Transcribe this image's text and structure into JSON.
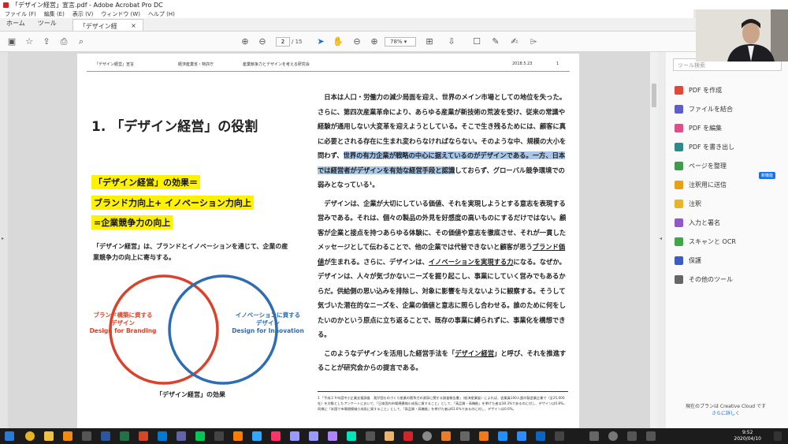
{
  "window": {
    "title": "「デザイン経営」宣言.pdf - Adobe Acrobat Pro DC"
  },
  "menu": [
    "ファイル (F)",
    "編集 (E)",
    "表示 (V)",
    "ウィンドウ (W)",
    "ヘルプ (H)"
  ],
  "tabs": {
    "home": "ホーム",
    "tools": "ツール",
    "document": "「デザイン経営」宣言...",
    "close": "×"
  },
  "toolbar": {
    "page_current": "2",
    "page_total": "/ 15",
    "zoom": "78%"
  },
  "pdf": {
    "header": {
      "h1": "「デザイン経営」宣言",
      "h2": "経済産業省・特許庁",
      "h3": "産業競争力とデザインを考える研究会",
      "date": "2018.5.23",
      "pagenum": "1"
    },
    "section_title": "1. 「デザイン経営」の役割",
    "yellow": [
      "「デザイン経営」の効果＝",
      "ブランド力向上+ イノベーション力向上",
      "=企業競争力の向上"
    ],
    "left_text": "「デザイン経営」は、ブランドとイノベーションを通じて、企業の産業競争力の向上に寄与する。",
    "venn": {
      "left_l1": "ブランド構築に資する",
      "left_l2": "デザイン",
      "left_l3": "Design for Branding",
      "right_l1": "イノベーションに資する",
      "right_l2": "デザイン",
      "right_l3": "Design for Innovation",
      "caption": "「デザイン経営」の効果",
      "color_left": "#d9432b",
      "color_right": "#2f6db3"
    },
    "p1_a": "日本は人口・労働力の減少局面を迎え、世界のメイン市場としての地位を失った。さらに、第四次産業革命により、あらゆる産業が新技術の荒波を受け、従来の常識や経験が通用しない大変革を迎えようとしている。そこで生き残るためには、顧客に真に必要とされる存在に生まれ変わらなければならない。そのような中、規模の大小を問わず、",
    "p1_hl": "世界の有力企業が戦略の中心に据えているのがデザインである。一方、日本では経営者がデザインを有効な経営手段と認識",
    "p1_b": "しておらず、グローバル競争環境での弱みとなっている¹。",
    "p2_a": "デザインは、企業が大切にしている価値、それを実現しようとする意志を表現する営みである。それは、個々の製品の外見を好感度の高いものにするだけではない。顧客が企業と接点を持つあらゆる体験に、その価値や意志を徹底させ、それが一貫したメッセージとして伝わることで、他の企業では代替できないと顧客が思う",
    "p2_ul1": "ブランド価値",
    "p2_b": "が生まれる。さらに、デザインは、",
    "p2_ul2": "イノベーションを実現する力",
    "p2_c": "になる。なぜか。デザインは、人々が気づかないニーズを掘り起こし、事業にしていく営みでもあるからだ。供給側の思い込みを排除し、対象に影響を与えないように観察する。そうして気づいた潜在的なニーズを、企業の価値と意志に照らし合わせる。誰のために何をしたいのかという原点に立ち返ることで、既存の事業に縛られずに、事業化を構想できる。",
    "p3_a": "このようなデザインを活用した経営手法を「",
    "p3_ul": "デザイン経営",
    "p3_b": "」と呼び、それを推進することが研究会からの提言である。",
    "footnote": "1 「平成２９年度中小企業支援調査　我が国ものづくり産業の競争力の源泉に関する調査報告書」（経済産業省）によれば、従業員100人超の製造業企業で（全25,000社）を対象としたアンケートにおいて、「日本国内市場規模縮小成長に資すること」として、「高品質・高機能」を挙げた者は38.3%であるのに対し、デザインは0.8%。同様に「米国で市場規模縮小成長に資すること」として、「高品質・高機能」を挙げた者は63.6%であるのに対し、デザインは0.0%。"
  },
  "right_panel": {
    "search_placeholder": "ツール検索",
    "tools": [
      {
        "label": "PDF を作成",
        "color": "#e0483a"
      },
      {
        "label": "ファイルを結合",
        "color": "#5b5fc7"
      },
      {
        "label": "PDF を編集",
        "color": "#e04e8a"
      },
      {
        "label": "PDF を書き出し",
        "color": "#2d8a8a"
      },
      {
        "label": "ページを整理",
        "color": "#3f9b49"
      },
      {
        "label": "注釈用に送信",
        "color": "#e5a11a"
      },
      {
        "label": "注釈",
        "color": "#e7b52a"
      },
      {
        "label": "入力と署名",
        "color": "#9257c9"
      },
      {
        "label": "スキャンと OCR",
        "color": "#3fa64a"
      },
      {
        "label": "保護",
        "color": "#3b5cc4"
      },
      {
        "label": "その他のツール",
        "color": "#666666"
      }
    ],
    "new_badge": "新機能",
    "cloud_text": "現在のプランは Creative Cloud です",
    "cloud_link": "さらに詳しく"
  },
  "taskbar": {
    "time": "9:52",
    "date": "2020/04/10"
  }
}
